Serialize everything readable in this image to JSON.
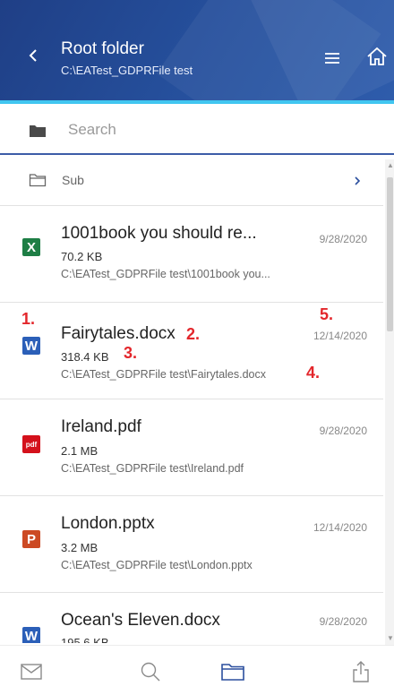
{
  "header": {
    "title": "Root folder",
    "subtitle": "C:\\EATest_GDPRFile test",
    "accent_color": "#41c6f0",
    "background_color": "#26519e"
  },
  "search": {
    "placeholder": "Search",
    "value": ""
  },
  "subfolder": {
    "label": "Sub"
  },
  "files": [
    {
      "name": "1001book you should re...",
      "size": "70.2 KB",
      "path": "C:\\EATest_GDPRFile test\\1001book you...",
      "date": "9/28/2020",
      "type_icon": "excel-icon",
      "icon_text": "X",
      "icon_color": "#1e7e45"
    },
    {
      "name": "Fairytales.docx",
      "size": "318.4 KB",
      "path": "C:\\EATest_GDPRFile test\\Fairytales.docx",
      "date": "12/14/2020",
      "type_icon": "word-icon",
      "icon_text": "W",
      "icon_color": "#2b5fb8"
    },
    {
      "name": "Ireland.pdf",
      "size": "2.1 MB",
      "path": "C:\\EATest_GDPRFile test\\Ireland.pdf",
      "date": "9/28/2020",
      "type_icon": "pdf-icon",
      "icon_text": "pdf",
      "icon_color": "#d4111b"
    },
    {
      "name": "London.pptx",
      "size": "3.2 MB",
      "path": "C:\\EATest_GDPRFile test\\London.pptx",
      "date": "12/14/2020",
      "type_icon": "powerpoint-icon",
      "icon_text": "P",
      "icon_color": "#cc4a24"
    },
    {
      "name": "Ocean's Eleven.docx",
      "size": "195.6 KB",
      "path": "",
      "date": "9/28/2020",
      "type_icon": "word-icon",
      "icon_text": "W",
      "icon_color": "#2b5fb8"
    }
  ],
  "annotations": [
    "1.",
    "2.",
    "3.",
    "4.",
    "5."
  ],
  "annotation_color": "#e3262b",
  "bottom_nav": [
    "mail-icon",
    "search-icon",
    "folder-icon",
    "share-icon"
  ],
  "nav_active_color": "#2b4f9e"
}
